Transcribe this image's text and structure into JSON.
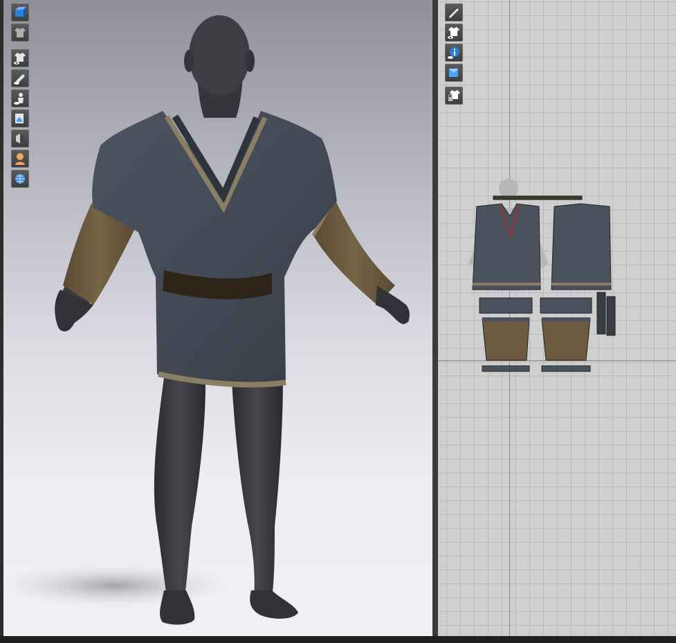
{
  "app": {
    "accent": "#2b7fd6"
  },
  "viewport3d": {
    "background_top": "#8e8f98",
    "background_bottom": "#f1f1f5",
    "toolbar": [
      {
        "name": "simulation-mode-icon",
        "color": "#2b7fd6"
      },
      {
        "name": "garment-display-icon",
        "color": "#b0b0b0"
      },
      {
        "name": "show-garment-icon",
        "color": "#e6e6e6"
      },
      {
        "name": "show-pins-icon",
        "color": "#2b7fd6"
      },
      {
        "name": "show-avatar-icon",
        "color": "#e6e6e6"
      },
      {
        "name": "texture-display-icon",
        "color": "#4aa3ff"
      },
      {
        "name": "shading-icon",
        "color": "#cfcfcf"
      },
      {
        "name": "avatar-skin-icon",
        "color": "#f2a45a"
      },
      {
        "name": "environment-icon",
        "color": "#3d8fe0"
      }
    ]
  },
  "viewport2d": {
    "background": "#cfcfcf",
    "toolbar": [
      {
        "name": "edit-pattern-icon",
        "color": "#e6e6e6"
      },
      {
        "name": "show-pattern-icon",
        "color": "#ffffff"
      },
      {
        "name": "info-icon",
        "color": "#2b7fd6"
      },
      {
        "name": "texture-2d-icon",
        "color": "#4aa3ff"
      },
      {
        "name": "lock-pattern-icon",
        "color": "#ffffff"
      }
    ]
  },
  "garment": {
    "tunic_color": "#434a55",
    "sleeve_color": "#6b5a40",
    "trim_color": "#8a7e64",
    "belt_color": "#2e2419",
    "avatar_color": "#3b3c3f",
    "seam_color": "#b8262c"
  }
}
